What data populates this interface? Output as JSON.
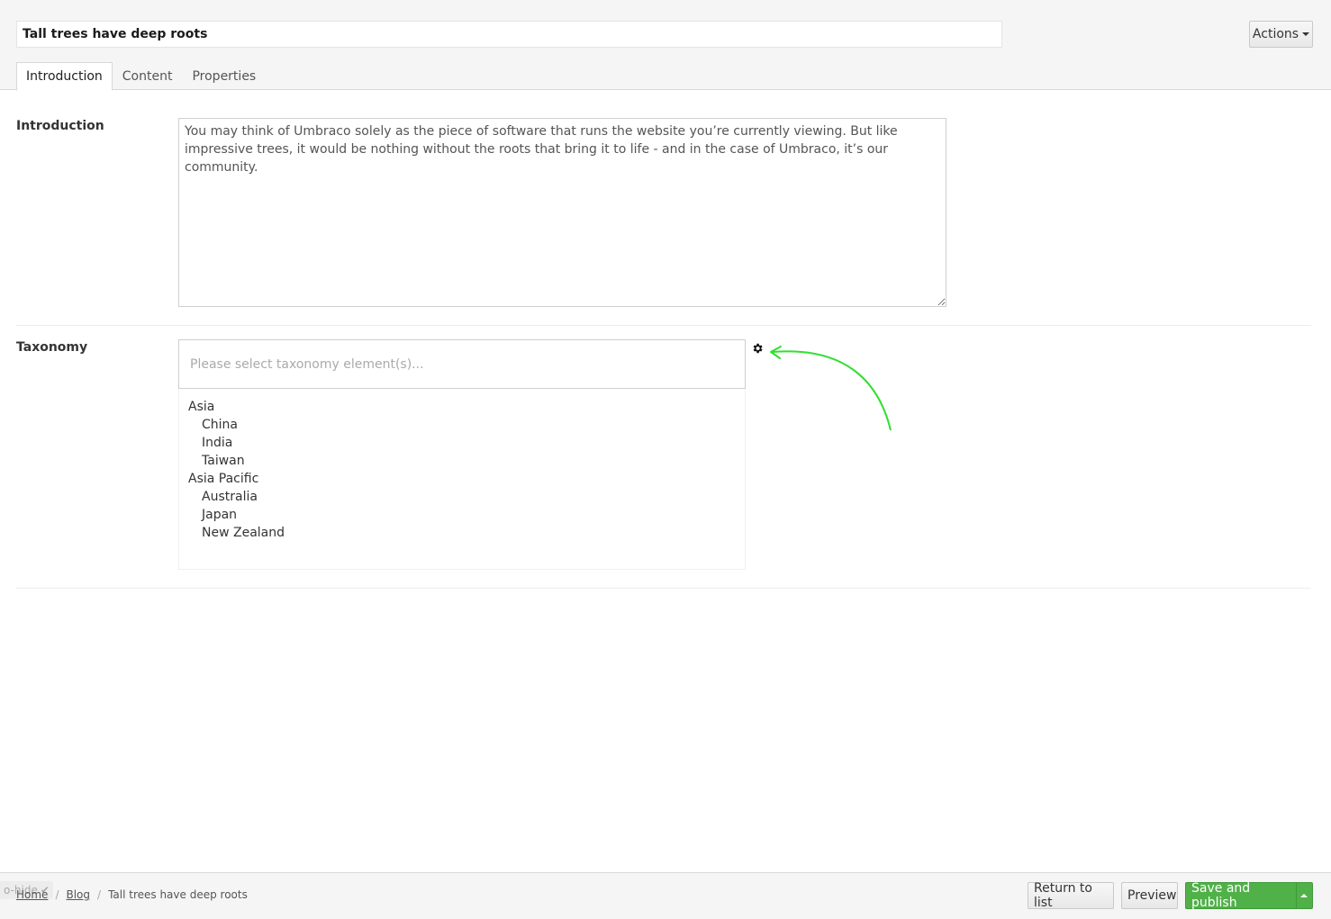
{
  "header": {
    "title_value": "Tall trees have deep roots",
    "actions_label": "Actions",
    "tabs": [
      {
        "label": "Introduction",
        "active": true
      },
      {
        "label": "Content",
        "active": false
      },
      {
        "label": "Properties",
        "active": false
      }
    ]
  },
  "introduction": {
    "label": "Introduction",
    "text": "You may think of Umbraco solely as the piece of software that runs the website you’re currently viewing. But like impressive trees, it would be nothing without the roots that bring it to life - and in the case of Umbraco, it’s our community."
  },
  "taxonomy": {
    "label": "Taxonomy",
    "placeholder": "Please select taxonomy element(s)...",
    "items": [
      {
        "label": "Asia",
        "level": 0
      },
      {
        "label": "China",
        "level": 1
      },
      {
        "label": "India",
        "level": 1
      },
      {
        "label": "Taiwan",
        "level": 1
      },
      {
        "label": "Asia Pacific",
        "level": 0
      },
      {
        "label": "Australia",
        "level": 1
      },
      {
        "label": "Japan",
        "level": 1
      },
      {
        "label": "New Zealand",
        "level": 1
      }
    ]
  },
  "footer": {
    "autohide_label": "o-hide",
    "breadcrumb": [
      "Home",
      "Blog",
      "Tall trees have deep roots"
    ],
    "return_label": "Return to list",
    "preview_label": "Preview",
    "publish_label": "Save and publish"
  },
  "colors": {
    "accent_green": "#50b148",
    "annotation_arrow": "#2fe02f"
  }
}
